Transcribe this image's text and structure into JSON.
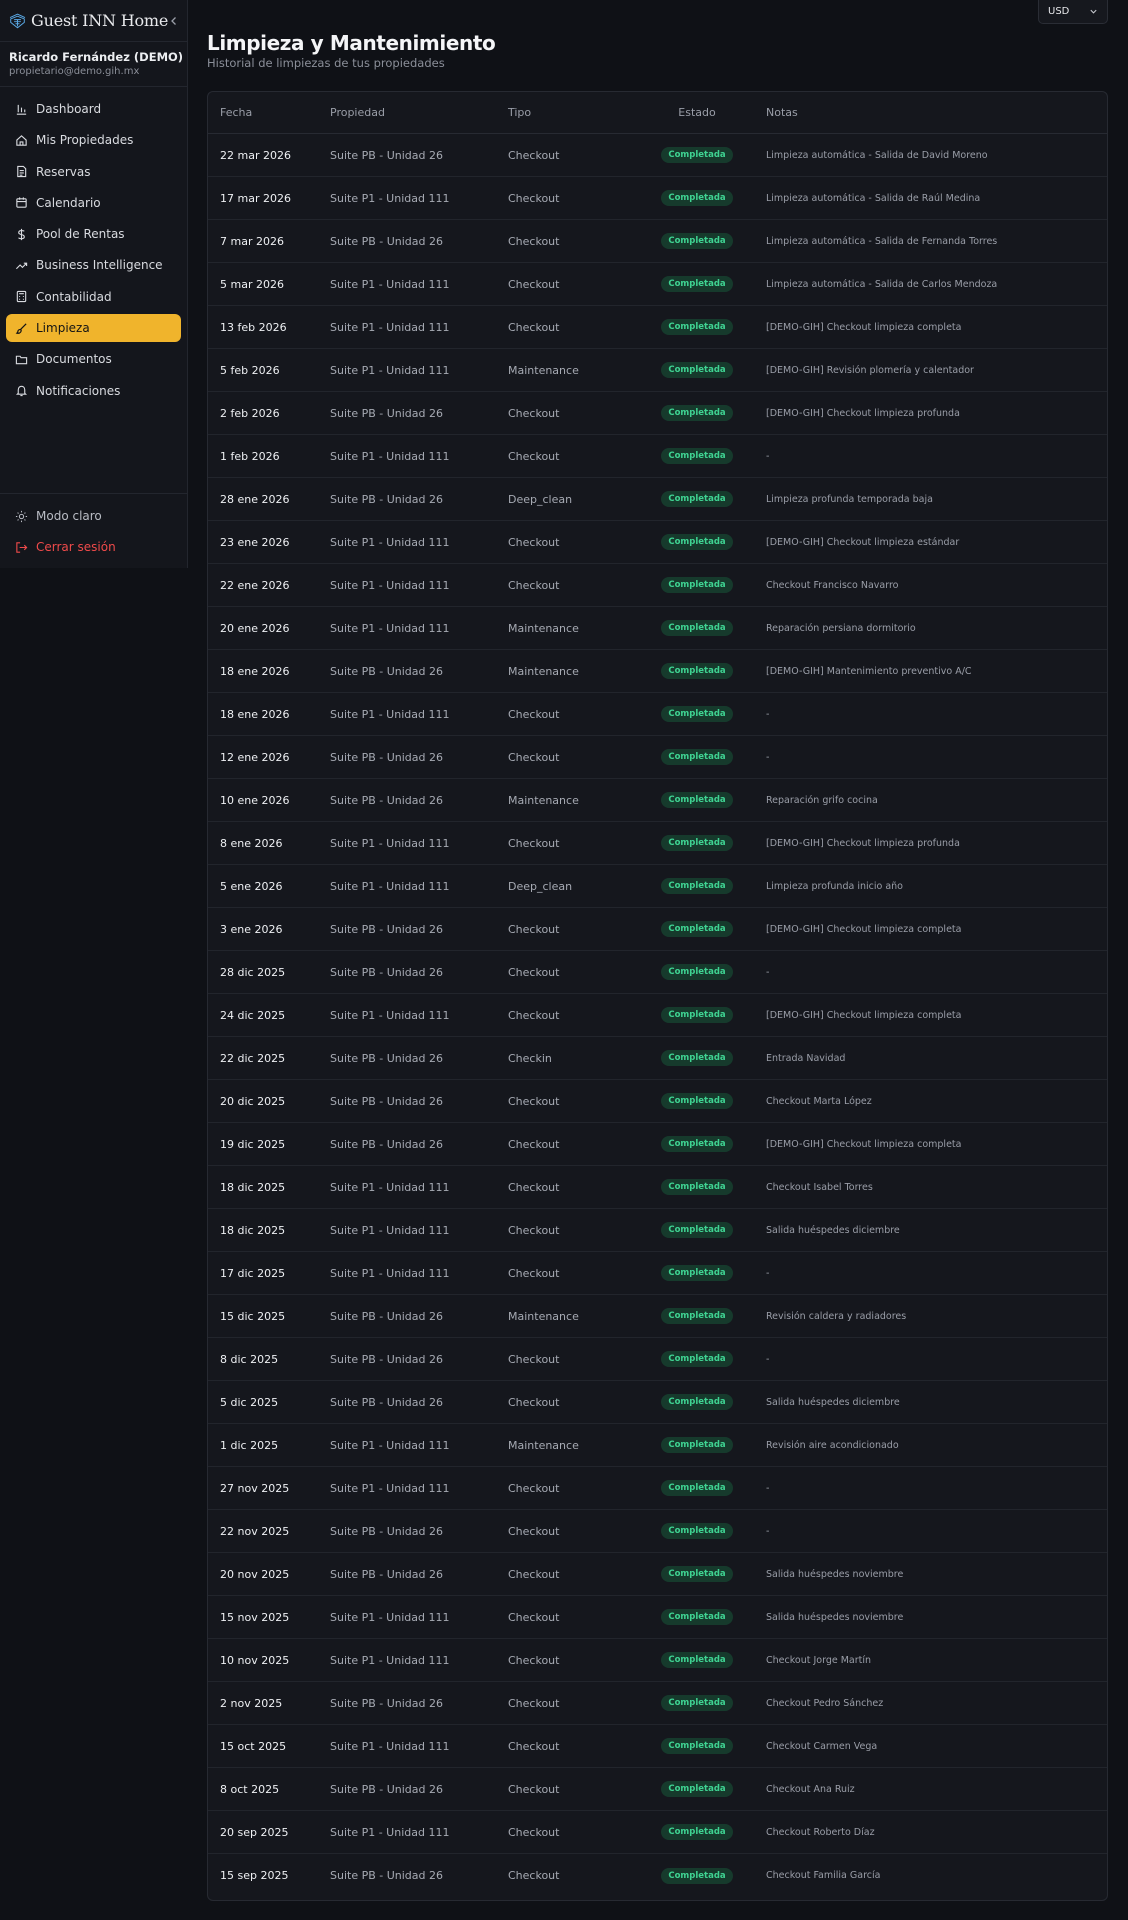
{
  "app": {
    "name": "Guest INN Home",
    "currency": "USD"
  },
  "user": {
    "name": "Ricardo Fernández (DEMO)",
    "email": "propietario@demo.gih.mx"
  },
  "nav": [
    {
      "label": "Dashboard",
      "icon": "bar-chart-icon"
    },
    {
      "label": "Mis Propiedades",
      "icon": "home-icon"
    },
    {
      "label": "Reservas",
      "icon": "file-text-icon"
    },
    {
      "label": "Calendario",
      "icon": "calendar-icon"
    },
    {
      "label": "Pool de Rentas",
      "icon": "dollar-icon"
    },
    {
      "label": "Business Intelligence",
      "icon": "trending-up-icon"
    },
    {
      "label": "Contabilidad",
      "icon": "calculator-icon"
    },
    {
      "label": "Limpieza",
      "icon": "brush-icon",
      "active": true
    },
    {
      "label": "Documentos",
      "icon": "folder-icon"
    },
    {
      "label": "Notificaciones",
      "icon": "bell-icon"
    }
  ],
  "bottom": {
    "theme_label": "Modo claro",
    "logout_label": "Cerrar sesión"
  },
  "page": {
    "title": "Limpieza y Mantenimiento",
    "subtitle": "Historial de limpiezas de tus propiedades"
  },
  "table": {
    "headers": {
      "date": "Fecha",
      "property": "Propiedad",
      "type": "Tipo",
      "status": "Estado",
      "notes": "Notas"
    },
    "rows": [
      {
        "date": "22 mar 2026",
        "property": "Suite PB - Unidad 26",
        "type": "Checkout",
        "status": "Completada",
        "notes": "Limpieza automática - Salida de David Moreno"
      },
      {
        "date": "17 mar 2026",
        "property": "Suite P1 - Unidad 111",
        "type": "Checkout",
        "status": "Completada",
        "notes": "Limpieza automática - Salida de Raúl Medina"
      },
      {
        "date": "7 mar 2026",
        "property": "Suite PB - Unidad 26",
        "type": "Checkout",
        "status": "Completada",
        "notes": "Limpieza automática - Salida de Fernanda Torres"
      },
      {
        "date": "5 mar 2026",
        "property": "Suite P1 - Unidad 111",
        "type": "Checkout",
        "status": "Completada",
        "notes": "Limpieza automática - Salida de Carlos Mendoza"
      },
      {
        "date": "13 feb 2026",
        "property": "Suite P1 - Unidad 111",
        "type": "Checkout",
        "status": "Completada",
        "notes": "[DEMO-GIH] Checkout limpieza completa"
      },
      {
        "date": "5 feb 2026",
        "property": "Suite P1 - Unidad 111",
        "type": "Maintenance",
        "status": "Completada",
        "notes": "[DEMO-GIH] Revisión plomería y calentador"
      },
      {
        "date": "2 feb 2026",
        "property": "Suite PB - Unidad 26",
        "type": "Checkout",
        "status": "Completada",
        "notes": "[DEMO-GIH] Checkout limpieza profunda"
      },
      {
        "date": "1 feb 2026",
        "property": "Suite P1 - Unidad 111",
        "type": "Checkout",
        "status": "Completada",
        "notes": "-"
      },
      {
        "date": "28 ene 2026",
        "property": "Suite PB - Unidad 26",
        "type": "Deep_clean",
        "status": "Completada",
        "notes": "Limpieza profunda temporada baja"
      },
      {
        "date": "23 ene 2026",
        "property": "Suite P1 - Unidad 111",
        "type": "Checkout",
        "status": "Completada",
        "notes": "[DEMO-GIH] Checkout limpieza estándar"
      },
      {
        "date": "22 ene 2026",
        "property": "Suite P1 - Unidad 111",
        "type": "Checkout",
        "status": "Completada",
        "notes": "Checkout Francisco Navarro"
      },
      {
        "date": "20 ene 2026",
        "property": "Suite P1 - Unidad 111",
        "type": "Maintenance",
        "status": "Completada",
        "notes": "Reparación persiana dormitorio"
      },
      {
        "date": "18 ene 2026",
        "property": "Suite PB - Unidad 26",
        "type": "Maintenance",
        "status": "Completada",
        "notes": "[DEMO-GIH] Mantenimiento preventivo A/C"
      },
      {
        "date": "18 ene 2026",
        "property": "Suite P1 - Unidad 111",
        "type": "Checkout",
        "status": "Completada",
        "notes": "-"
      },
      {
        "date": "12 ene 2026",
        "property": "Suite PB - Unidad 26",
        "type": "Checkout",
        "status": "Completada",
        "notes": "-"
      },
      {
        "date": "10 ene 2026",
        "property": "Suite PB - Unidad 26",
        "type": "Maintenance",
        "status": "Completada",
        "notes": "Reparación grifo cocina"
      },
      {
        "date": "8 ene 2026",
        "property": "Suite P1 - Unidad 111",
        "type": "Checkout",
        "status": "Completada",
        "notes": "[DEMO-GIH] Checkout limpieza profunda"
      },
      {
        "date": "5 ene 2026",
        "property": "Suite P1 - Unidad 111",
        "type": "Deep_clean",
        "status": "Completada",
        "notes": "Limpieza profunda inicio año"
      },
      {
        "date": "3 ene 2026",
        "property": "Suite PB - Unidad 26",
        "type": "Checkout",
        "status": "Completada",
        "notes": "[DEMO-GIH] Checkout limpieza completa"
      },
      {
        "date": "28 dic 2025",
        "property": "Suite PB - Unidad 26",
        "type": "Checkout",
        "status": "Completada",
        "notes": "-"
      },
      {
        "date": "24 dic 2025",
        "property": "Suite P1 - Unidad 111",
        "type": "Checkout",
        "status": "Completada",
        "notes": "[DEMO-GIH] Checkout limpieza completa"
      },
      {
        "date": "22 dic 2025",
        "property": "Suite PB - Unidad 26",
        "type": "Checkin",
        "status": "Completada",
        "notes": "Entrada Navidad"
      },
      {
        "date": "20 dic 2025",
        "property": "Suite PB - Unidad 26",
        "type": "Checkout",
        "status": "Completada",
        "notes": "Checkout Marta López"
      },
      {
        "date": "19 dic 2025",
        "property": "Suite PB - Unidad 26",
        "type": "Checkout",
        "status": "Completada",
        "notes": "[DEMO-GIH] Checkout limpieza completa"
      },
      {
        "date": "18 dic 2025",
        "property": "Suite P1 - Unidad 111",
        "type": "Checkout",
        "status": "Completada",
        "notes": "Checkout Isabel Torres"
      },
      {
        "date": "18 dic 2025",
        "property": "Suite P1 - Unidad 111",
        "type": "Checkout",
        "status": "Completada",
        "notes": "Salida huéspedes diciembre"
      },
      {
        "date": "17 dic 2025",
        "property": "Suite P1 - Unidad 111",
        "type": "Checkout",
        "status": "Completada",
        "notes": "-"
      },
      {
        "date": "15 dic 2025",
        "property": "Suite PB - Unidad 26",
        "type": "Maintenance",
        "status": "Completada",
        "notes": "Revisión caldera y radiadores"
      },
      {
        "date": "8 dic 2025",
        "property": "Suite PB - Unidad 26",
        "type": "Checkout",
        "status": "Completada",
        "notes": "-"
      },
      {
        "date": "5 dic 2025",
        "property": "Suite PB - Unidad 26",
        "type": "Checkout",
        "status": "Completada",
        "notes": "Salida huéspedes diciembre"
      },
      {
        "date": "1 dic 2025",
        "property": "Suite P1 - Unidad 111",
        "type": "Maintenance",
        "status": "Completada",
        "notes": "Revisión aire acondicionado"
      },
      {
        "date": "27 nov 2025",
        "property": "Suite P1 - Unidad 111",
        "type": "Checkout",
        "status": "Completada",
        "notes": "-"
      },
      {
        "date": "22 nov 2025",
        "property": "Suite PB - Unidad 26",
        "type": "Checkout",
        "status": "Completada",
        "notes": "-"
      },
      {
        "date": "20 nov 2025",
        "property": "Suite PB - Unidad 26",
        "type": "Checkout",
        "status": "Completada",
        "notes": "Salida huéspedes noviembre"
      },
      {
        "date": "15 nov 2025",
        "property": "Suite P1 - Unidad 111",
        "type": "Checkout",
        "status": "Completada",
        "notes": "Salida huéspedes noviembre"
      },
      {
        "date": "10 nov 2025",
        "property": "Suite P1 - Unidad 111",
        "type": "Checkout",
        "status": "Completada",
        "notes": "Checkout Jorge Martín"
      },
      {
        "date": "2 nov 2025",
        "property": "Suite PB - Unidad 26",
        "type": "Checkout",
        "status": "Completada",
        "notes": "Checkout Pedro Sánchez"
      },
      {
        "date": "15 oct 2025",
        "property": "Suite P1 - Unidad 111",
        "type": "Checkout",
        "status": "Completada",
        "notes": "Checkout Carmen Vega"
      },
      {
        "date": "8 oct 2025",
        "property": "Suite PB - Unidad 26",
        "type": "Checkout",
        "status": "Completada",
        "notes": "Checkout Ana Ruiz"
      },
      {
        "date": "20 sep 2025",
        "property": "Suite P1 - Unidad 111",
        "type": "Checkout",
        "status": "Completada",
        "notes": "Checkout Roberto Díaz"
      },
      {
        "date": "15 sep 2025",
        "property": "Suite PB - Unidad 26",
        "type": "Checkout",
        "status": "Completada",
        "notes": "Checkout Familia García"
      }
    ]
  },
  "colors": {
    "accent": "#f0b42c",
    "status_completed": "#3fd392",
    "logout": "#ef4a4a"
  }
}
